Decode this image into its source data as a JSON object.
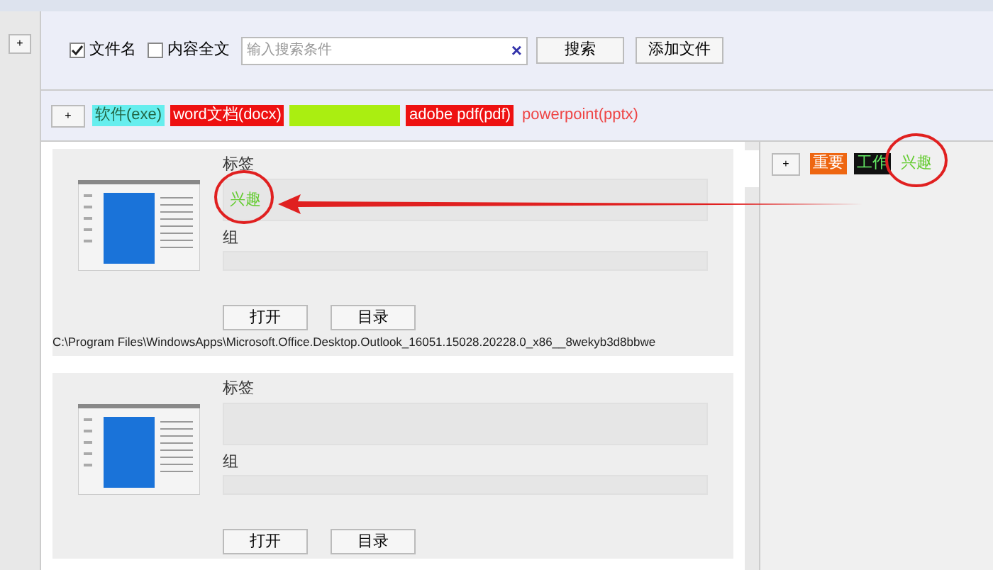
{
  "side_button": "+",
  "search": {
    "filename_checkbox": {
      "label": "文件名",
      "checked": true
    },
    "fulltext_checkbox": {
      "label": "内容全文",
      "checked": false
    },
    "placeholder": "输入搜索条件",
    "clear": "×",
    "search_button": "搜索",
    "add_button": "添加文件"
  },
  "type_tags": {
    "add": "+",
    "items": [
      {
        "label": "软件(exe)",
        "kind": "soft",
        "color": "#66eeee"
      },
      {
        "label": "word文档(docx)",
        "kind": "filled",
        "color": "#ee1111"
      },
      {
        "kind": "filled",
        "color": "#aaee11"
      },
      {
        "label": "adobe pdf(pdf)",
        "kind": "filled",
        "color": "#ee1111"
      },
      {
        "label": "powerpoint(pptx)",
        "kind": "text",
        "color": "#ee4444"
      }
    ]
  },
  "files": [
    {
      "tags_label": "标签",
      "tags": [
        {
          "label": "兴趣",
          "kind": "text",
          "color": "#66cc33"
        }
      ],
      "group_label": "组",
      "open": "打开",
      "folder": "目录",
      "path": "C:\\Program Files\\WindowsApps\\Microsoft.Office.Desktop.Outlook_16051.15028.20228.0_x86__8wekyb3d8bbwe"
    },
    {
      "tags_label": "标签",
      "group_label": "组",
      "open": "打开",
      "folder": "目录"
    }
  ],
  "tag_panel": {
    "add": "+",
    "items": [
      {
        "label": "重要",
        "kind": "filled",
        "color": "#ee6611"
      },
      {
        "label": "工作",
        "kind": "glow",
        "color": "#111111"
      },
      {
        "label": "兴趣",
        "kind": "text",
        "color": "#66cc33"
      }
    ]
  }
}
